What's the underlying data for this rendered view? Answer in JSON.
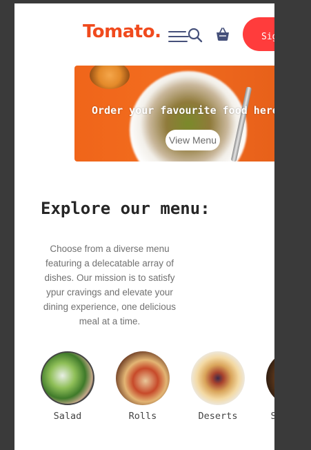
{
  "header": {
    "logo": "Tomato.",
    "signin_label": "Sign in"
  },
  "hero": {
    "title": "Order your favourite food here",
    "button_label": "View Menu"
  },
  "explore": {
    "heading": "Explore our menu:",
    "text": "Choose from a diverse menu featuring a delecatable array of dishes. Our mission is to satisfy ypur cravings and elevate your dining experience, one delicious meal at a time.",
    "items": [
      {
        "label": "Salad"
      },
      {
        "label": "Rolls"
      },
      {
        "label": "Deserts"
      },
      {
        "label": "Sandwich"
      }
    ]
  },
  "colors": {
    "brand": "#f04a1d",
    "signin": "#ff3c3c",
    "hero_bg": "#f0651a"
  }
}
